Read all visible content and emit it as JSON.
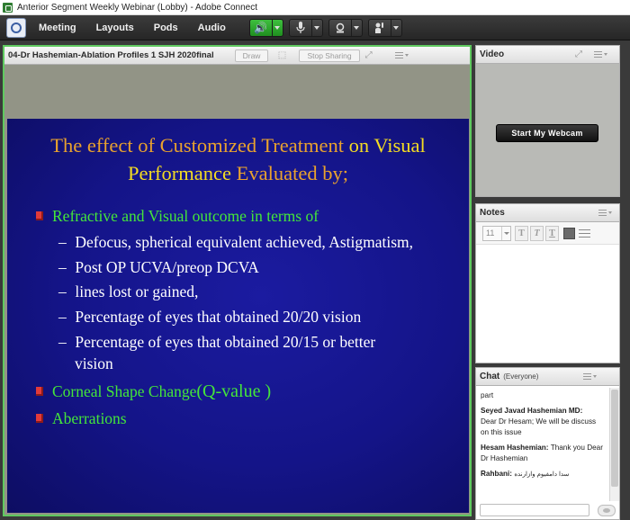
{
  "window": {
    "title": "Anterior Segment Weekly Webinar (Lobby) - Adobe Connect"
  },
  "menu": {
    "items": [
      "Meeting",
      "Layouts",
      "Pods",
      "Audio"
    ]
  },
  "colors": {
    "active_pod_border": "#5fc95f",
    "slide_bg": "#141488",
    "slide_bullet_text": "#44e63a",
    "slide_title_yellow": "#f4dc22",
    "slide_title_orange": "#e9a22e"
  },
  "toolbar": {
    "icons": [
      "speaker-icon",
      "microphone-icon",
      "camera-icon",
      "raise-hand-icon"
    ]
  },
  "share_pod": {
    "title": "04-Dr Hashemian-Ablation Profiles 1 SJH 2020final",
    "draw_label": "Draw",
    "stop_sharing_label": "Stop Sharing"
  },
  "slide": {
    "title_part1": "The effect of Customized Treatment ",
    "title_part2": "on Visual",
    "title_part3": "Performance ",
    "title_part4": "Evaluated by;",
    "bullet1": "Refractive and Visual outcome in terms of",
    "sub1": "Defocus, spherical equivalent achieved, Astigmatism,",
    "sub2": "Post OP UCVA/preop DCVA",
    "sub3": "lines lost or gained,",
    "sub4": "Percentage of eyes that obtained 20/20 vision",
    "sub5a": "Percentage of eyes that obtained 20/15 or better",
    "sub5b": "vision",
    "bullet2a": "Corneal Shape Change",
    "bullet2b": "(Q-value )",
    "bullet3": "Aberrations"
  },
  "video_pod": {
    "title": "Video",
    "webcam_label": "Start My Webcam"
  },
  "notes_pod": {
    "title": "Notes",
    "font_size": "11",
    "fmt_buttons": [
      "T",
      "T",
      "T"
    ]
  },
  "chat_pod": {
    "title": "Chat",
    "audience": "(Everyone)",
    "messages": {
      "m0": "part",
      "m1_sender": "Seyed Javad Hashemian MD:",
      "m1_text": "Dear Dr Hesam; We will be discuss on this issue",
      "m2_sender": "Hesam Hashemian:",
      "m2_text": "Thank you Dear Dr Hashemian",
      "m3_sender": "Rahbani:",
      "m3_text": "سدا دامفیوم وازارنده"
    }
  }
}
